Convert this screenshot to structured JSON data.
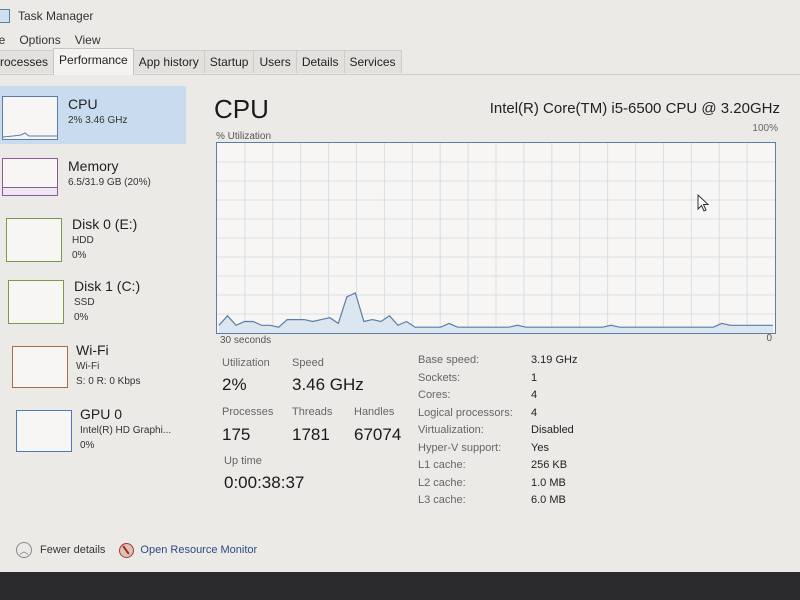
{
  "window": {
    "title": "Task Manager"
  },
  "menu": [
    "File",
    "Options",
    "View"
  ],
  "menu_visible": [
    "le",
    "Options",
    "View"
  ],
  "tabs": [
    {
      "label": "rocesses",
      "full": "Processes"
    },
    {
      "label": "Performance",
      "active": true
    },
    {
      "label": "App history"
    },
    {
      "label": "Startup"
    },
    {
      "label": "Users"
    },
    {
      "label": "Details"
    },
    {
      "label": "Services"
    }
  ],
  "sidebar": {
    "items": [
      {
        "name": "CPU",
        "line1": "2% 3.46 GHz",
        "line2": "",
        "color": "#5a7ea8",
        "active": true
      },
      {
        "name": "Memory",
        "line1": "6.5/31.9 GB (20%)",
        "line2": "",
        "color": "#8a5a9a"
      },
      {
        "name": "Disk 0 (E:)",
        "line1": "HDD",
        "line2": "0%",
        "color": "#7a9a4a"
      },
      {
        "name": "Disk 1 (C:)",
        "line1": "SSD",
        "line2": "0%",
        "color": "#7a9a4a"
      },
      {
        "name": "Wi-Fi",
        "line1": "Wi-Fi",
        "line2": "S: 0 R: 0 Kbps",
        "color": "#a86a4a"
      },
      {
        "name": "GPU 0",
        "line1": "Intel(R) HD Graphi...",
        "line2": "0%",
        "color": "#4a7ab8"
      }
    ]
  },
  "main": {
    "title": "CPU",
    "model": "Intel(R) Core(TM) i5-6500 CPU @ 3.20GHz",
    "util_label": "% Utilization",
    "util_max": "100%",
    "axis_left": "30 seconds",
    "axis_right": "0",
    "stats": {
      "utilization_label": "Utilization",
      "utilization": "2%",
      "speed_label": "Speed",
      "speed": "3.46 GHz",
      "processes_label": "Processes",
      "processes": "175",
      "threads_label": "Threads",
      "threads": "1781",
      "handles_label": "Handles",
      "handles": "67074",
      "uptime_label": "Up time",
      "uptime": "0:00:38:37"
    },
    "info": [
      {
        "key": "Base speed:",
        "value": "3.19 GHz"
      },
      {
        "key": "Sockets:",
        "value": "1"
      },
      {
        "key": "Cores:",
        "value": "4"
      },
      {
        "key": "Logical processors:",
        "value": "4"
      },
      {
        "key": "Virtualization:",
        "value": "Disabled"
      },
      {
        "key": "Hyper-V support:",
        "value": "Yes"
      },
      {
        "key": "L1 cache:",
        "value": "256 KB"
      },
      {
        "key": "L2 cache:",
        "value": "1.0 MB"
      },
      {
        "key": "L3 cache:",
        "value": "6.0 MB"
      }
    ]
  },
  "graph": {
    "accent": "#5a7ea8",
    "fill": "#dbe6f1",
    "cpu_percent_history": [
      3,
      8,
      3,
      5,
      5,
      3,
      3,
      2,
      6,
      6,
      6,
      5,
      6,
      7,
      4,
      18,
      20,
      5,
      6,
      5,
      8,
      3,
      5,
      2,
      2,
      2,
      2,
      4,
      2,
      2,
      2,
      2,
      2,
      2,
      2,
      3,
      2,
      2,
      2,
      2,
      2,
      2,
      2,
      2,
      2,
      2,
      3,
      2,
      2,
      2,
      2,
      2,
      2,
      2,
      2,
      2,
      2,
      2,
      2,
      4,
      3,
      3,
      3,
      3,
      3,
      3
    ]
  },
  "footer": {
    "fewer_details": "Fewer details",
    "open_resource_monitor": "Open Resource Monitor"
  }
}
